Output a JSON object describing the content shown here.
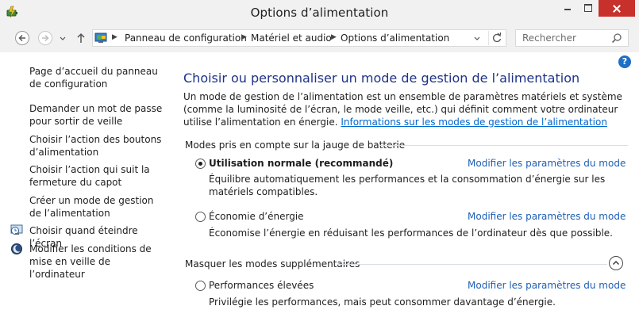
{
  "window": {
    "title": "Options d’alimentation"
  },
  "navigation": {
    "breadcrumbs": [
      "Panneau de configuration",
      "Matériel et audio",
      "Options d’alimentation"
    ],
    "separator": "▶",
    "search_placeholder": "Rechercher"
  },
  "sidebar": {
    "items": [
      {
        "label": "Page d’accueil du panneau de configuration"
      },
      {
        "label": "Demander un mot de passe pour sortir de veille"
      },
      {
        "label": "Choisir l’action des boutons d’alimentation"
      },
      {
        "label": "Choisir l’action qui suit la fermeture du capot"
      },
      {
        "label": "Créer un mode de gestion de l’alimentation"
      },
      {
        "label": "Choisir quand éteindre l’écran",
        "icon": "clock-display-icon"
      },
      {
        "label": "Modifier les conditions de mise en veille de l’ordinateur",
        "icon": "moon-sleep-icon"
      }
    ]
  },
  "main": {
    "title": "Choisir ou personnaliser un mode de gestion de l’alimentation",
    "intro": "Un mode de gestion de l’alimentation est un ensemble de paramètres matériels et système (comme la luminosité de l’écran, le mode veille, etc.) qui définit comment votre ordinateur utilise l’alimentation en énergie.",
    "intro_link": "Informations sur les modes de gestion de l’alimentation",
    "group1_header": "Modes pris en compte sur la jauge de batterie",
    "group2_header": "Masquer les modes supplémentaires",
    "plans": [
      {
        "name": "Utilisation normale (recommandé)",
        "selected": true,
        "link": "Modifier les paramètres du mode",
        "description": "Équilibre automatiquement les performances et la consommation d’énergie sur les matériels compatibles."
      },
      {
        "name": "Économie d’énergie",
        "selected": false,
        "link": "Modifier les paramètres du mode",
        "description": "Économise l’énergie en réduisant les performances de l’ordinateur dès que possible."
      },
      {
        "name": "Performances élevées",
        "selected": false,
        "link": "Modifier les paramètres du mode",
        "description": "Privilégie les performances, mais peut consommer davantage d’énergie."
      }
    ],
    "help_label": "?"
  },
  "colors": {
    "title": "#1e3287",
    "link": "#1e5fb4",
    "close_button": "#c7302b",
    "chrome": "#f1f1f1"
  }
}
